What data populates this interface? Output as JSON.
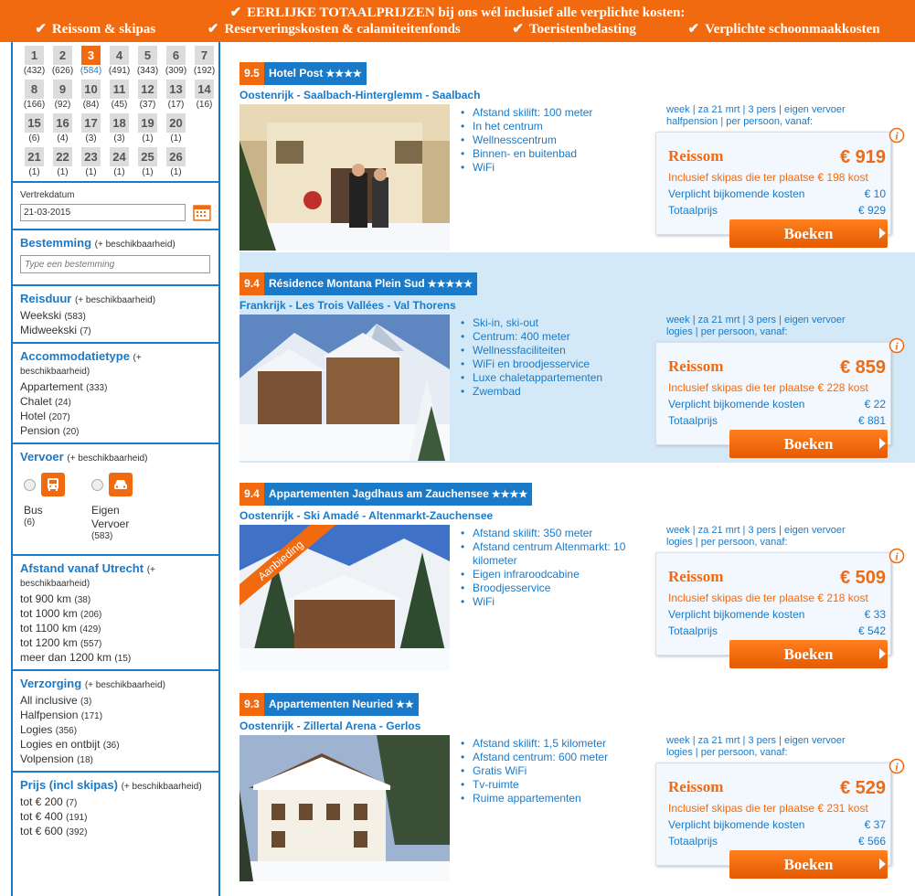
{
  "banner": {
    "title": "EERLIJKE TOTAALPRIJZEN bij ons wél inclusief alle verplichte kosten:",
    "items": [
      "Reissom & skipas",
      "Reserveringskosten & calamiteitenfonds",
      "Toeristenbelasting",
      "Verplichte schoonmaakkosten"
    ]
  },
  "calendar": {
    "rows": [
      [
        {
          "d": "1",
          "c": "(432)"
        },
        {
          "d": "2",
          "c": "(626)"
        },
        {
          "d": "3",
          "c": "(584)",
          "sel": true
        },
        {
          "d": "4",
          "c": "(491)"
        },
        {
          "d": "5",
          "c": "(343)"
        },
        {
          "d": "6",
          "c": "(309)"
        },
        {
          "d": "7",
          "c": "(192)"
        }
      ],
      [
        {
          "d": "8",
          "c": "(166)"
        },
        {
          "d": "9",
          "c": "(92)"
        },
        {
          "d": "10",
          "c": "(84)"
        },
        {
          "d": "11",
          "c": "(45)"
        },
        {
          "d": "12",
          "c": "(37)"
        },
        {
          "d": "13",
          "c": "(17)"
        },
        {
          "d": "14",
          "c": "(16)"
        }
      ],
      [
        {
          "d": "15",
          "c": "(6)"
        },
        {
          "d": "16",
          "c": "(4)"
        },
        {
          "d": "17",
          "c": "(3)"
        },
        {
          "d": "18",
          "c": "(3)"
        },
        {
          "d": "19",
          "c": "(1)"
        },
        {
          "d": "20",
          "c": "(1)"
        }
      ],
      [
        {
          "d": "21",
          "c": "(1)"
        },
        {
          "d": "22",
          "c": "(1)"
        },
        {
          "d": "23",
          "c": "(1)"
        },
        {
          "d": "24",
          "c": "(1)"
        },
        {
          "d": "25",
          "c": "(1)"
        },
        {
          "d": "26",
          "c": "(1)"
        }
      ]
    ]
  },
  "vertrek": {
    "label": "Vertrekdatum",
    "value": "21-03-2015"
  },
  "hint": "(+ beschikbaarheid)",
  "bestemming": {
    "title": "Bestemming",
    "placeholder": "Type een bestemming"
  },
  "reisduur": {
    "title": "Reisduur",
    "items": [
      {
        "l": "Weekski",
        "c": "(583)"
      },
      {
        "l": "Midweekski",
        "c": "(7)"
      }
    ]
  },
  "accommodatie": {
    "title": "Accommodatietype",
    "items": [
      {
        "l": "Appartement",
        "c": "(333)"
      },
      {
        "l": "Chalet",
        "c": "(24)"
      },
      {
        "l": "Hotel",
        "c": "(207)"
      },
      {
        "l": "Pension",
        "c": "(20)"
      }
    ]
  },
  "vervoer": {
    "title": "Vervoer",
    "items": [
      {
        "l": "Bus",
        "c": "(6)"
      },
      {
        "l": "Eigen Vervoer",
        "c": "(583)"
      }
    ]
  },
  "afstand": {
    "title": "Afstand vanaf Utrecht",
    "items": [
      {
        "l": "tot 900 km",
        "c": "(38)"
      },
      {
        "l": "tot 1000 km",
        "c": "(206)"
      },
      {
        "l": "tot 1100 km",
        "c": "(429)"
      },
      {
        "l": "tot 1200 km",
        "c": "(557)"
      },
      {
        "l": "meer dan 1200 km",
        "c": "(15)"
      }
    ]
  },
  "verzorging": {
    "title": "Verzorging",
    "items": [
      {
        "l": "All inclusive",
        "c": "(3)"
      },
      {
        "l": "Halfpension",
        "c": "(171)"
      },
      {
        "l": "Logies",
        "c": "(356)"
      },
      {
        "l": "Logies en ontbijt",
        "c": "(36)"
      },
      {
        "l": "Volpension",
        "c": "(18)"
      }
    ]
  },
  "prijs": {
    "title": "Prijs (incl skipas)",
    "items": [
      {
        "l": "tot € 200",
        "c": "(7)"
      },
      {
        "l": "tot € 400",
        "c": "(191)"
      },
      {
        "l": "tot € 600",
        "c": "(392)"
      }
    ]
  },
  "results": [
    {
      "score": "9.5",
      "name": "Hotel Post",
      "stars": "★★★★",
      "location": "Oostenrijk - Saalbach-Hinterglemm - Saalbach",
      "features": [
        "Afstand skilift: 100 meter",
        "In het centrum",
        "Wellnesscentrum",
        "Binnen- en buitenbad",
        "WiFi"
      ],
      "meta1": "week | za 21 mrt | 3 pers | eigen vervoer",
      "meta2": "halfpension | per persoon, vanaf:",
      "reissom_label": "Reissom",
      "price": "€ 919",
      "skipas": "Inclusief skipas die ter plaatse € 198 kost",
      "extra_label": "Verplicht bijkomende kosten",
      "extra": "€ 10",
      "total_label": "Totaalprijs",
      "total": "€ 929",
      "button": "Boeken"
    },
    {
      "score": "9.4",
      "name": "Résidence Montana Plein Sud",
      "stars": "★★★★★",
      "location": "Frankrijk - Les Trois Vallées - Val Thorens",
      "features": [
        "Ski-in, ski-out",
        "Centrum: 400 meter",
        "Wellnessfaciliteiten",
        "WiFi en broodjesservice",
        "Luxe chaletappartementen",
        "Zwembad"
      ],
      "meta1": "week | za 21 mrt | 3 pers | eigen vervoer",
      "meta2": "logies | per persoon, vanaf:",
      "reissom_label": "Reissom",
      "price": "€ 859",
      "skipas": "Inclusief skipas die ter plaatse € 228 kost",
      "extra_label": "Verplicht bijkomende kosten",
      "extra": "€ 22",
      "total_label": "Totaalprijs",
      "total": "€ 881",
      "button": "Boeken"
    },
    {
      "score": "9.4",
      "name": "Appartementen Jagdhaus am Zauchensee",
      "stars": "★★★★",
      "location": "Oostenrijk - Ski Amadé - Altenmarkt-Zauchensee",
      "features": [
        "Afstand skilift: 350 meter",
        "Afstand centrum Altenmarkt: 10 kilometer",
        "Eigen infraroodcabine",
        "Broodjesservice",
        "WiFi"
      ],
      "meta1": "week | za 21 mrt | 3 pers | eigen vervoer",
      "meta2": "logies | per persoon, vanaf:",
      "reissom_label": "Reissom",
      "price": "€ 509",
      "skipas": "Inclusief skipas die ter plaatse € 218 kost",
      "extra_label": "Verplicht bijkomende kosten",
      "extra": "€ 33",
      "total_label": "Totaalprijs",
      "total": "€ 542",
      "button": "Boeken",
      "ribbon": "Aanbieding"
    },
    {
      "score": "9.3",
      "name": "Appartementen Neuried",
      "stars": "★★",
      "location": "Oostenrijk - Zillertal Arena - Gerlos",
      "features": [
        "Afstand skilift: 1,5 kilometer",
        "Afstand centrum: 600 meter",
        "Gratis WiFi",
        "Tv-ruimte",
        "Ruime appartementen"
      ],
      "meta1": "week | za 21 mrt | 3 pers | eigen vervoer",
      "meta2": "logies | per persoon, vanaf:",
      "reissom_label": "Reissom",
      "price": "€ 529",
      "skipas": "Inclusief skipas die ter plaatse € 231 kost",
      "extra_label": "Verplicht bijkomende kosten",
      "extra": "€ 37",
      "total_label": "Totaalprijs",
      "total": "€ 566",
      "button": "Boeken"
    }
  ]
}
